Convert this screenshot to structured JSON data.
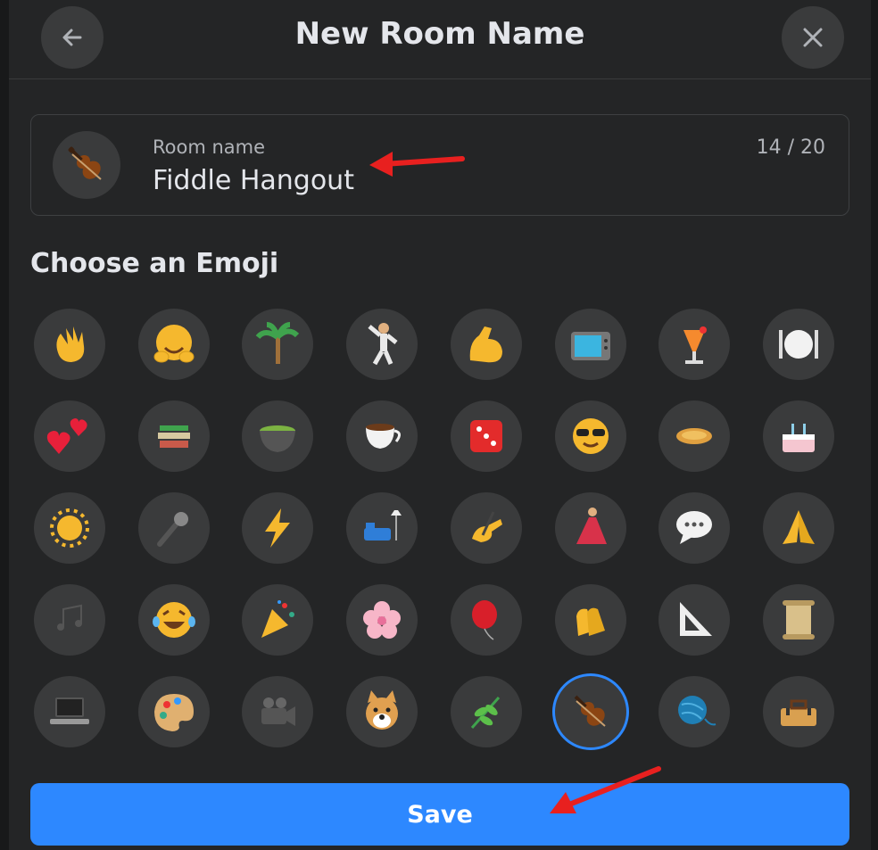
{
  "header": {
    "title": "New Room Name"
  },
  "name_field": {
    "label": "Room name",
    "value": "Fiddle Hangout",
    "count": "14 / 20"
  },
  "emoji_section": {
    "title": "Choose an Emoji"
  },
  "save_button": {
    "label": "Save"
  },
  "emoji_grid": [
    {
      "name": "waving-hand-emoji",
      "selected": false
    },
    {
      "name": "hugging-face-emoji",
      "selected": false
    },
    {
      "name": "palm-tree-emoji",
      "selected": false
    },
    {
      "name": "dancing-man-emoji",
      "selected": false
    },
    {
      "name": "flexed-biceps-emoji",
      "selected": false
    },
    {
      "name": "television-emoji",
      "selected": false
    },
    {
      "name": "tropical-drink-emoji",
      "selected": false
    },
    {
      "name": "fork-knife-plate-emoji",
      "selected": false
    },
    {
      "name": "two-hearts-emoji",
      "selected": false
    },
    {
      "name": "books-emoji",
      "selected": false
    },
    {
      "name": "pot-of-food-emoji",
      "selected": false
    },
    {
      "name": "hot-beverage-emoji",
      "selected": false
    },
    {
      "name": "dice-emoji",
      "selected": false
    },
    {
      "name": "smiling-face-sunglasses-emoji",
      "selected": false
    },
    {
      "name": "flatbread-emoji",
      "selected": false
    },
    {
      "name": "birthday-cake-emoji",
      "selected": false
    },
    {
      "name": "sun-emoji",
      "selected": false
    },
    {
      "name": "microphone-emoji",
      "selected": false
    },
    {
      "name": "high-voltage-emoji",
      "selected": false
    },
    {
      "name": "couch-lamp-emoji",
      "selected": false
    },
    {
      "name": "writing-hand-emoji",
      "selected": false
    },
    {
      "name": "dancing-woman-emoji",
      "selected": false
    },
    {
      "name": "speech-balloon-emoji",
      "selected": false
    },
    {
      "name": "folded-hands-emoji",
      "selected": false
    },
    {
      "name": "musical-notes-emoji",
      "selected": false
    },
    {
      "name": "laughing-tears-emoji",
      "selected": false
    },
    {
      "name": "party-popper-emoji",
      "selected": false
    },
    {
      "name": "cherry-blossom-emoji",
      "selected": false
    },
    {
      "name": "balloon-emoji",
      "selected": false
    },
    {
      "name": "clapping-hands-emoji",
      "selected": false
    },
    {
      "name": "triangular-ruler-emoji",
      "selected": false
    },
    {
      "name": "scroll-emoji",
      "selected": false
    },
    {
      "name": "laptop-emoji",
      "selected": false
    },
    {
      "name": "artist-palette-emoji",
      "selected": false
    },
    {
      "name": "movie-camera-emoji",
      "selected": false
    },
    {
      "name": "dog-face-emoji",
      "selected": false
    },
    {
      "name": "herb-emoji",
      "selected": false
    },
    {
      "name": "violin-emoji",
      "selected": true
    },
    {
      "name": "yarn-ball-emoji",
      "selected": false
    },
    {
      "name": "toolbox-emoji",
      "selected": false
    }
  ],
  "colors": {
    "accent": "#2d88ff",
    "background": "#242526",
    "annotation": "#e8201f"
  }
}
